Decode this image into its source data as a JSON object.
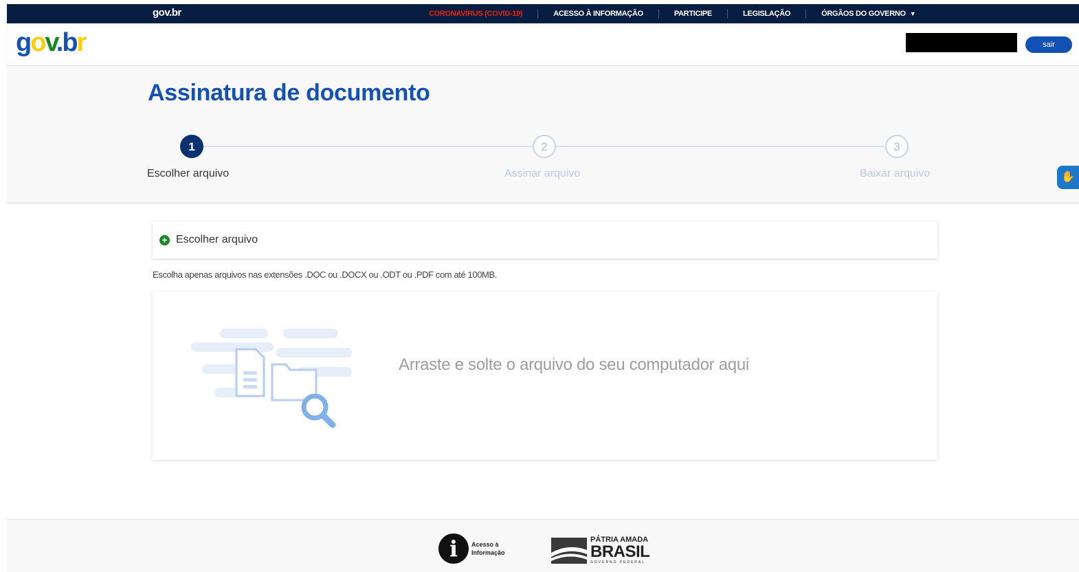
{
  "gov_bar": {
    "logo": "gov.br",
    "links": [
      {
        "label": "CORONAVÍRUS (COVID-19)",
        "highlight": true
      },
      {
        "label": "ACESSO À INFORMAÇÃO"
      },
      {
        "label": "PARTICIPE"
      },
      {
        "label": "LEGISLAÇÃO"
      },
      {
        "label": "ÓRGÃOS DO GOVERNO"
      }
    ]
  },
  "header": {
    "logo": "gov.br",
    "user_name_redacted": true,
    "logout_label": "sair"
  },
  "main": {
    "title": "Assinatura de documento",
    "steps": [
      {
        "number": "1",
        "label": "Escolher arquivo",
        "active": true
      },
      {
        "number": "2",
        "label": "Assinar arquivo",
        "active": false
      },
      {
        "number": "3",
        "label": "Baixar arquivo",
        "active": false
      }
    ],
    "choose_file_label": "Escolher arquivo",
    "hint": "Escolha apenas arquivos nas extensões .DOC ou .DOCX ou .ODT ou .PDF com até 100MB.",
    "dropzone_text": "Arraste e solte o arquivo do seu computador aqui"
  },
  "footer": {
    "acesso_line1": "Acesso à",
    "acesso_line2": "Informação",
    "brasil_top": "PÁTRIA AMADA",
    "brasil_main": "BRASIL",
    "brasil_bottom": "GOVERNO FEDERAL"
  },
  "colors": {
    "gov_bar_bg": "#071d41",
    "primary_blue": "#1351b4",
    "covid_red": "#e52207",
    "success_green": "#168821"
  }
}
